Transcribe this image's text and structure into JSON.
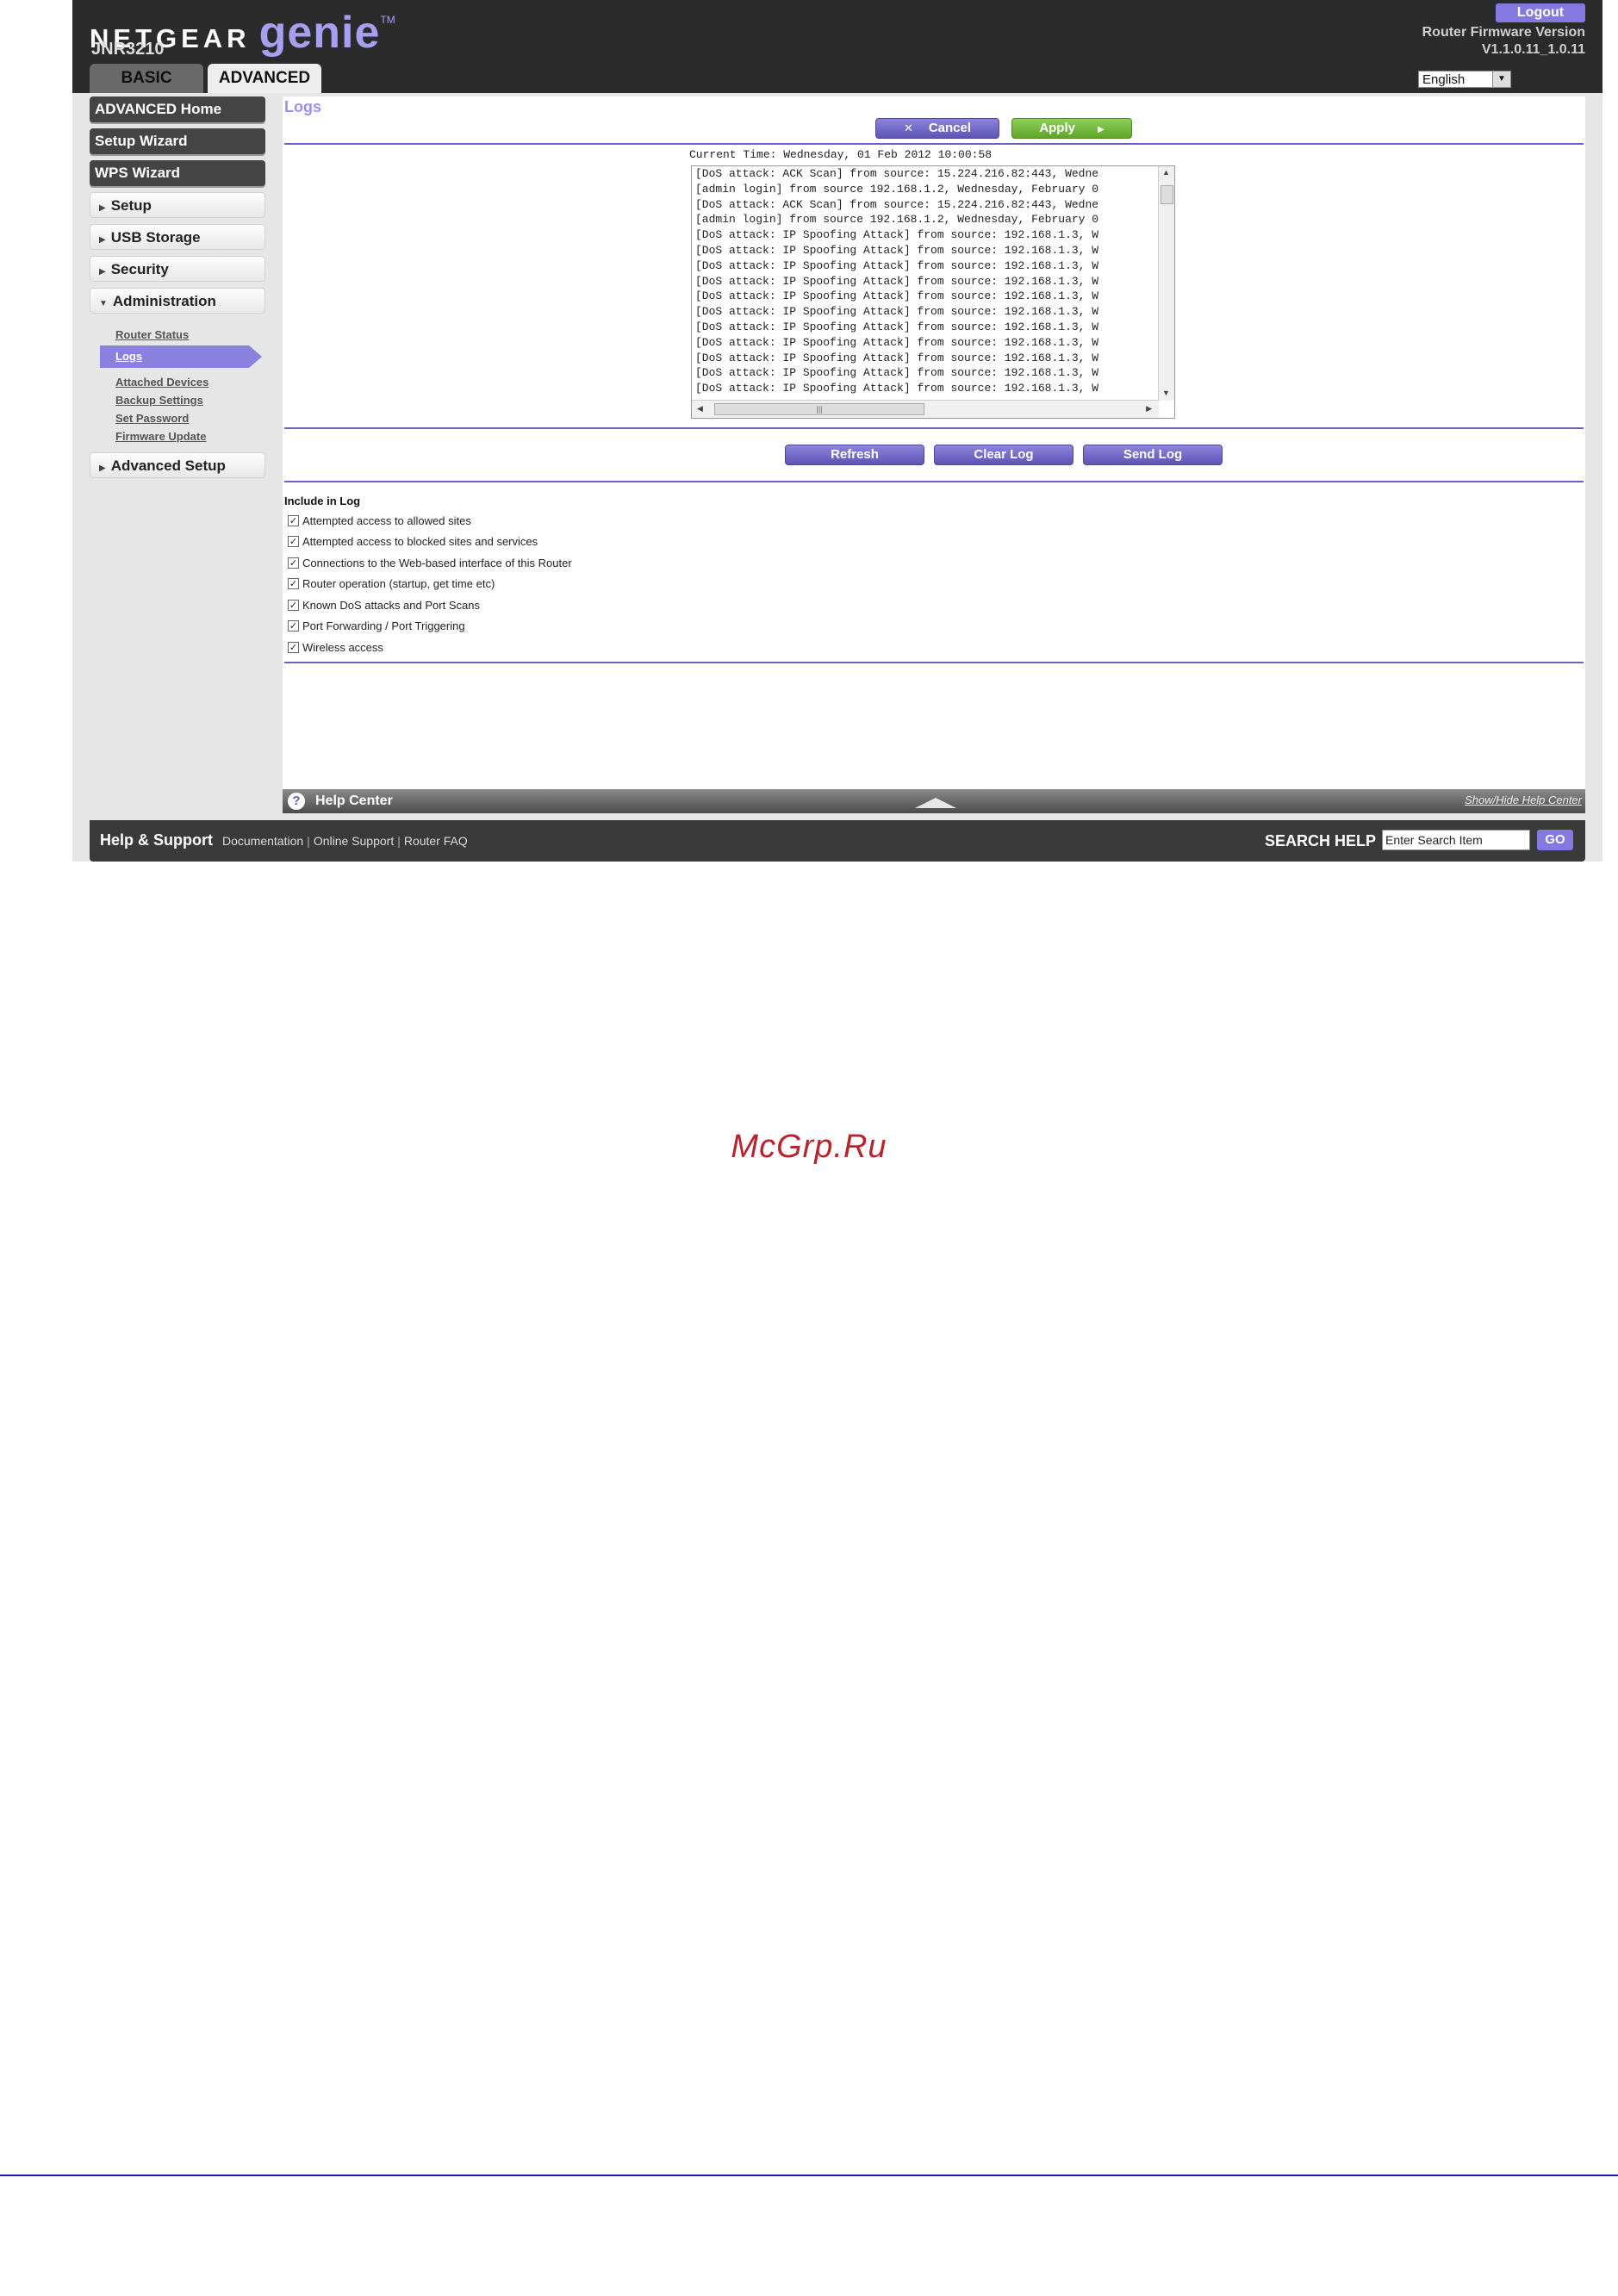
{
  "header": {
    "brand": "NETGEAR",
    "product": "genie",
    "tm": "TM",
    "model": "JNR3210",
    "tabs": [
      {
        "label": "BASIC"
      },
      {
        "label": "ADVANCED"
      }
    ],
    "logout": "Logout",
    "firmware_label": "Router Firmware Version",
    "firmware_version": "V1.1.0.11_1.0.11",
    "language": "English"
  },
  "sidebar": {
    "advanced_home": "ADVANCED Home",
    "setup_wizard": "Setup Wizard",
    "wps_wizard": "WPS Wizard",
    "setup": "Setup",
    "usb_storage": "USB Storage",
    "security": "Security",
    "administration": "Administration",
    "admin_items": [
      "Router Status",
      "Logs",
      "Attached Devices",
      "Backup Settings",
      "Set Password",
      "Firmware Update"
    ],
    "advanced_setup": "Advanced Setup"
  },
  "main": {
    "title": "Logs",
    "cancel": "Cancel",
    "apply": "Apply",
    "current_time": "Current Time: Wednesday, 01 Feb 2012 10:00:58",
    "log_lines": [
      "[DoS attack: ACK Scan] from source: 15.224.216.82:443, Wedne",
      "[admin login] from source 192.168.1.2, Wednesday, February 0",
      "[DoS attack: ACK Scan] from source: 15.224.216.82:443, Wedne",
      "[admin login] from source 192.168.1.2, Wednesday, February 0",
      "[DoS attack: IP Spoofing Attack] from source: 192.168.1.3, W",
      "[DoS attack: IP Spoofing Attack] from source: 192.168.1.3, W",
      "[DoS attack: IP Spoofing Attack] from source: 192.168.1.3, W",
      "[DoS attack: IP Spoofing Attack] from source: 192.168.1.3, W",
      "[DoS attack: IP Spoofing Attack] from source: 192.168.1.3, W",
      "[DoS attack: IP Spoofing Attack] from source: 192.168.1.3, W",
      "[DoS attack: IP Spoofing Attack] from source: 192.168.1.3, W",
      "[DoS attack: IP Spoofing Attack] from source: 192.168.1.3, W",
      "[DoS attack: IP Spoofing Attack] from source: 192.168.1.3, W",
      "[DoS attack: IP Spoofing Attack] from source: 192.168.1.3, W",
      "[DoS attack: IP Spoofing Attack] from source: 192.168.1.3, W"
    ],
    "refresh": "Refresh",
    "clear_log": "Clear Log",
    "send_log": "Send Log",
    "include_title": "Include in Log",
    "options": [
      {
        "label": "Attempted access to allowed sites",
        "checked": true
      },
      {
        "label": "Attempted access to blocked sites and services",
        "checked": true
      },
      {
        "label": "Connections to the Web-based interface of this Router",
        "checked": true
      },
      {
        "label": "Router operation (startup, get time etc)",
        "checked": true
      },
      {
        "label": "Known DoS attacks and Port Scans",
        "checked": true
      },
      {
        "label": "Port Forwarding / Port Triggering",
        "checked": true
      },
      {
        "label": "Wireless access",
        "checked": true
      }
    ]
  },
  "help": {
    "title": "Help Center",
    "toggle": "Show/Hide Help Center",
    "icon": "?"
  },
  "footer": {
    "title": "Help & Support",
    "links": [
      "Documentation",
      "Online Support",
      "Router FAQ"
    ],
    "search_label": "SEARCH HELP",
    "search_value": "Enter Search Item",
    "go": "GO"
  },
  "watermark": "McGrp.Ru",
  "colors": {
    "accent": "#8479e0",
    "header_bg": "#2b2b2b",
    "apply_green": "#6db23a",
    "rule": "#6a61c4",
    "watermark": "#b8232e"
  }
}
